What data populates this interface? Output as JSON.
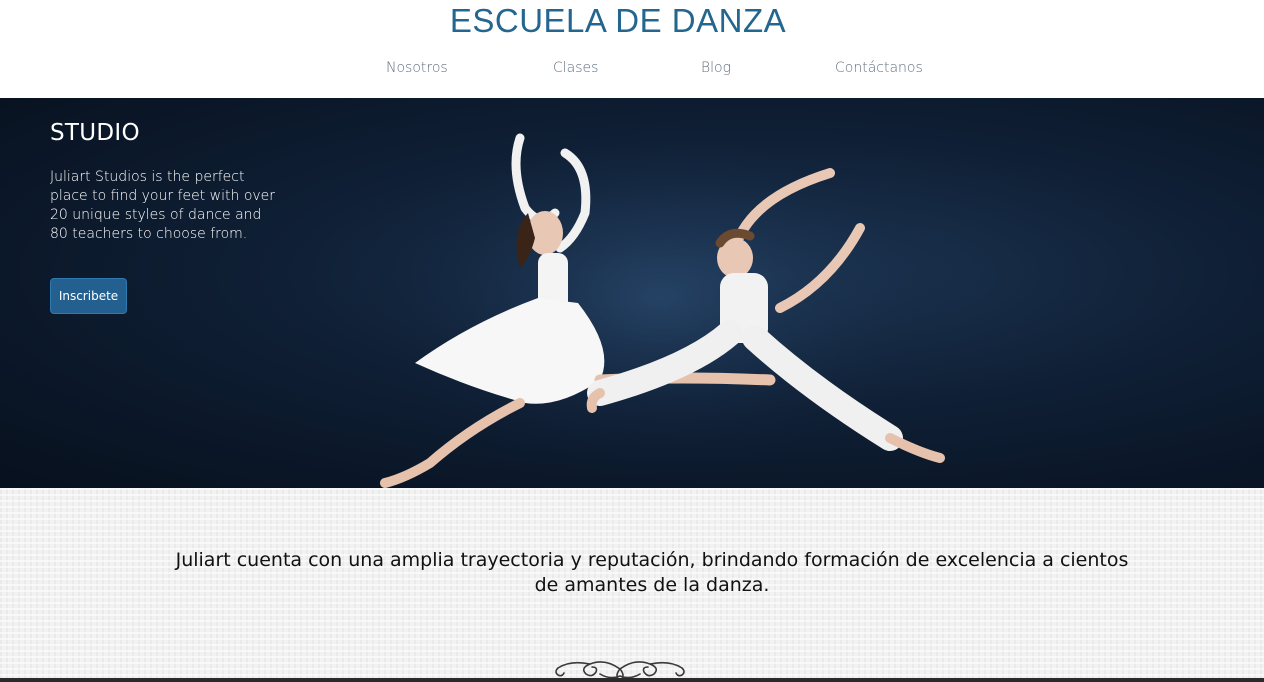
{
  "header": {
    "site_title": "ESCUELA DE DANZA",
    "nav": [
      {
        "label": "Nosotros"
      },
      {
        "label": "Clases"
      },
      {
        "label": "Blog"
      },
      {
        "label": "Contáctanos"
      }
    ]
  },
  "hero": {
    "heading": "STUDIO",
    "text": "Juliart Studios is the perfect place to find your feet with over 20 unique styles of dance and 80 teachers to choose from.",
    "button_label": "Inscribete",
    "image": "two-dancers-leaping-photo"
  },
  "about": {
    "text": "Juliart cuenta con una amplia trayectoria y reputación, brindando formación de excelencia a cientos de amantes de la danza.",
    "ornament": "flourish-divider-icon"
  },
  "colors": {
    "accent": "#23668f",
    "button": "#23608f",
    "hero_bg": "#0f1f35"
  }
}
